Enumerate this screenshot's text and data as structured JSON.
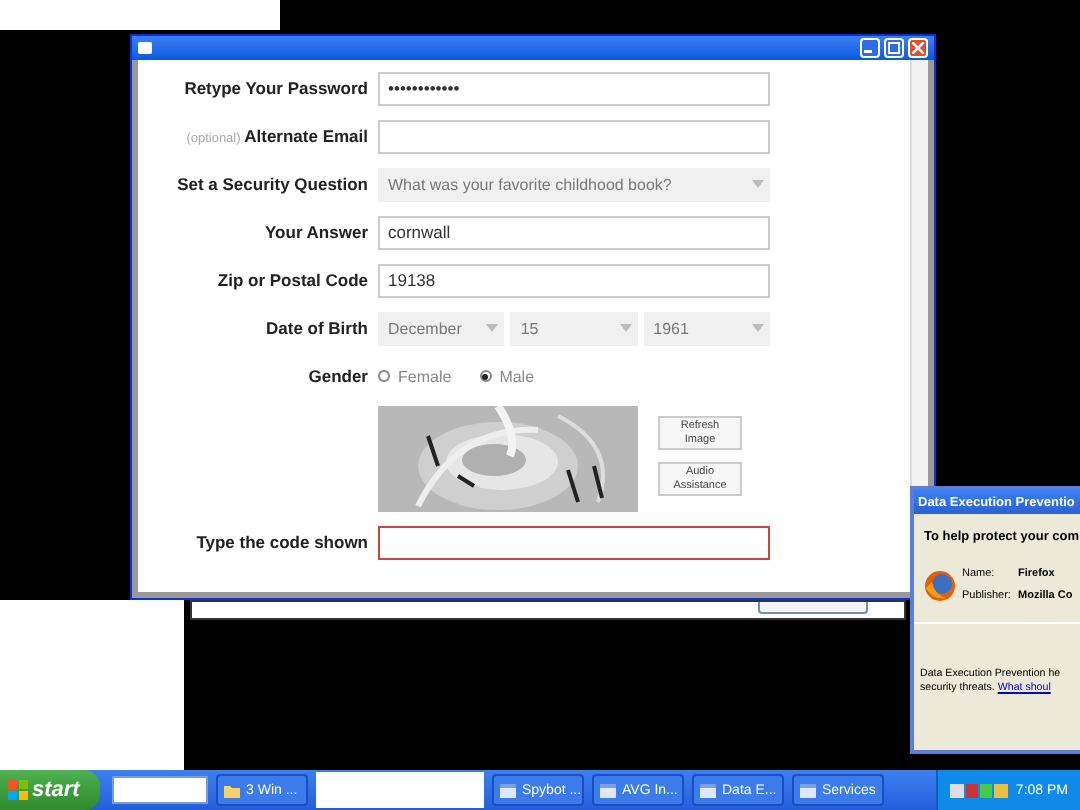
{
  "browser_window": {
    "rows": [
      {
        "kind": "text",
        "label": "Retype Your Password",
        "value": "••••••••••••"
      },
      {
        "kind": "text",
        "hint": "(optional)",
        "label": "Alternate Email"
      },
      {
        "kind": "select",
        "label": "Set a Security Question",
        "selects": [
          {
            "value": "What was your favorite childhood book?"
          }
        ]
      },
      {
        "kind": "text",
        "label": "Your Answer",
        "value": "cornwall"
      },
      {
        "kind": "text",
        "label": "Zip or Postal Code",
        "value": "19138"
      },
      {
        "kind": "select",
        "label": "Date of Birth",
        "selects": [
          {
            "value": "December"
          },
          {
            "value": "15"
          },
          {
            "value": "1961"
          }
        ]
      },
      {
        "kind": "radio",
        "label": "Gender",
        "options": [
          {
            "label": "Female",
            "selected": false
          },
          {
            "label": "Male",
            "selected": true
          }
        ]
      },
      {
        "kind": "captcha",
        "buttons": [
          "Refresh Image",
          "Audio Assistance"
        ]
      },
      {
        "kind": "code",
        "label": "Type the code shown"
      }
    ]
  },
  "dialog": {
    "title": "Data Execution Preventio",
    "heading": "To help protect your com",
    "info": [
      {
        "label": "Name:",
        "value": "Firefox"
      },
      {
        "label": "Publisher:",
        "value": "Mozilla Co"
      }
    ],
    "footer_line": "Data Execution Prevention he",
    "footer_rest": "security threats.",
    "footer_link": "What shoul"
  },
  "taskbar": {
    "start": "start",
    "items": [
      {
        "kind": "folder",
        "label": "3 Win ..."
      },
      {
        "kind": "app",
        "label": "Spybot ..."
      },
      {
        "kind": "app",
        "label": "AVG In..."
      },
      {
        "kind": "app",
        "label": "Data E..."
      },
      {
        "kind": "app",
        "label": "Services"
      }
    ],
    "clock": "7:08 PM"
  }
}
